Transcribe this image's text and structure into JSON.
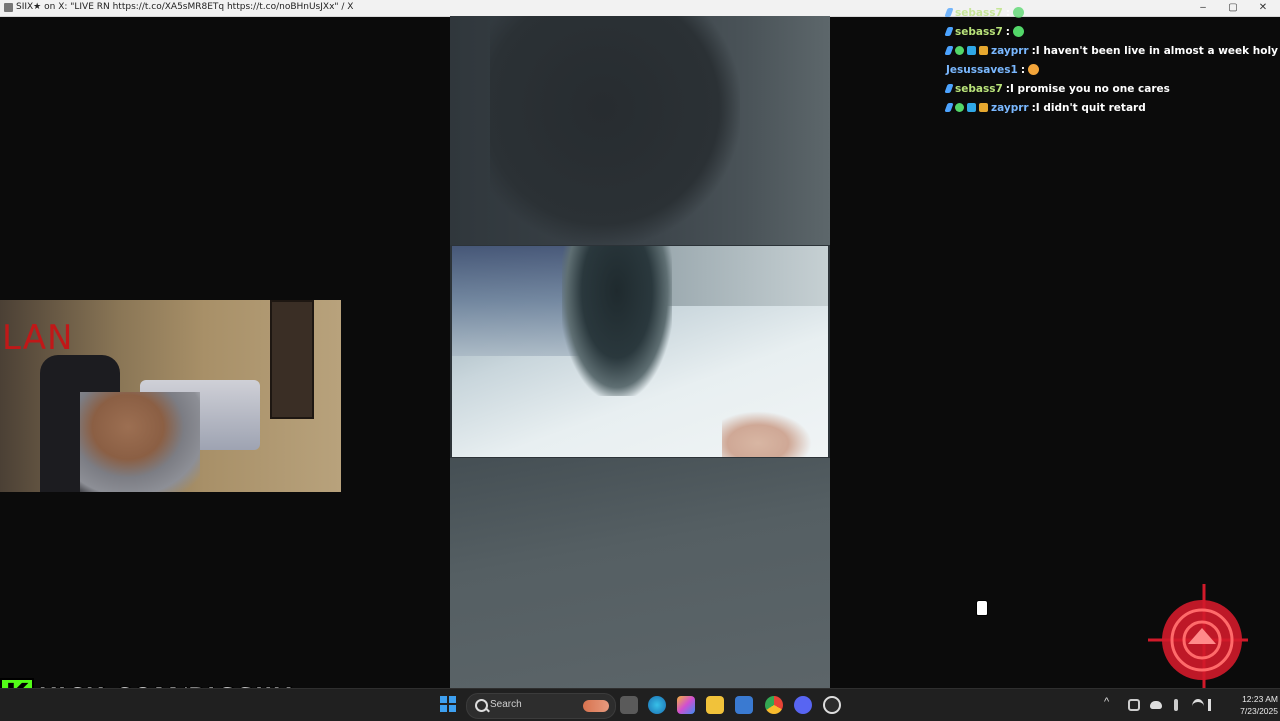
{
  "window": {
    "title": "SIIX★ on X: \"LIVE RN https://t.co/XA5sMR8ETq https://t.co/noBHnUsJXx\" / X",
    "minimize": "–",
    "maximize": "▢",
    "close": "✕"
  },
  "webcam_overlay": {
    "text": "LAN"
  },
  "chat": {
    "messages": [
      {
        "user": "sebass7",
        "sep": " :",
        "text": "",
        "emote": "green",
        "badges": [
          "pen"
        ],
        "dim": true
      },
      {
        "user": "sebass7",
        "sep": " :",
        "text": "",
        "emote": "green",
        "badges": [
          "pen"
        ],
        "dim": false
      },
      {
        "user": "zayprr",
        "sep": " :",
        "text": " I haven't been live in almost a week holy shi",
        "emote": "",
        "badges": [
          "pen",
          "check",
          "cube",
          "box"
        ],
        "dim": false
      },
      {
        "user": "Jesussaves1",
        "sep": " :",
        "text": "",
        "emote": "grin",
        "badges": [],
        "dim": false
      },
      {
        "user": "sebass7",
        "sep": " :",
        "text": " I promise you no one cares",
        "emote": "",
        "badges": [
          "pen"
        ],
        "dim": false
      },
      {
        "user": "zayprr",
        "sep": " :",
        "text": " I didn't quit retard",
        "emote": "",
        "badges": [
          "pen",
          "check",
          "cube",
          "box"
        ],
        "dim": false
      }
    ]
  },
  "kick_banner": {
    "logo": "K",
    "url": "KICK.COM/BIGSIIX"
  },
  "taskbar": {
    "search_label": "Search",
    "time": "12:23 AM",
    "date": "7/23/2025",
    "tray_chevron": "^",
    "apps": [
      "file-explorer-icon",
      "edge-icon",
      "copilot-icon",
      "folder-icon",
      "store-icon",
      "chrome-icon",
      "discord-icon",
      "obs-icon"
    ]
  },
  "colors": {
    "kick_green": "#53fc18",
    "taskbar_bg": "#202020",
    "chat_text": "#ffffff",
    "username_green": "#b9e37a",
    "username_blue": "#7ab8ff"
  }
}
